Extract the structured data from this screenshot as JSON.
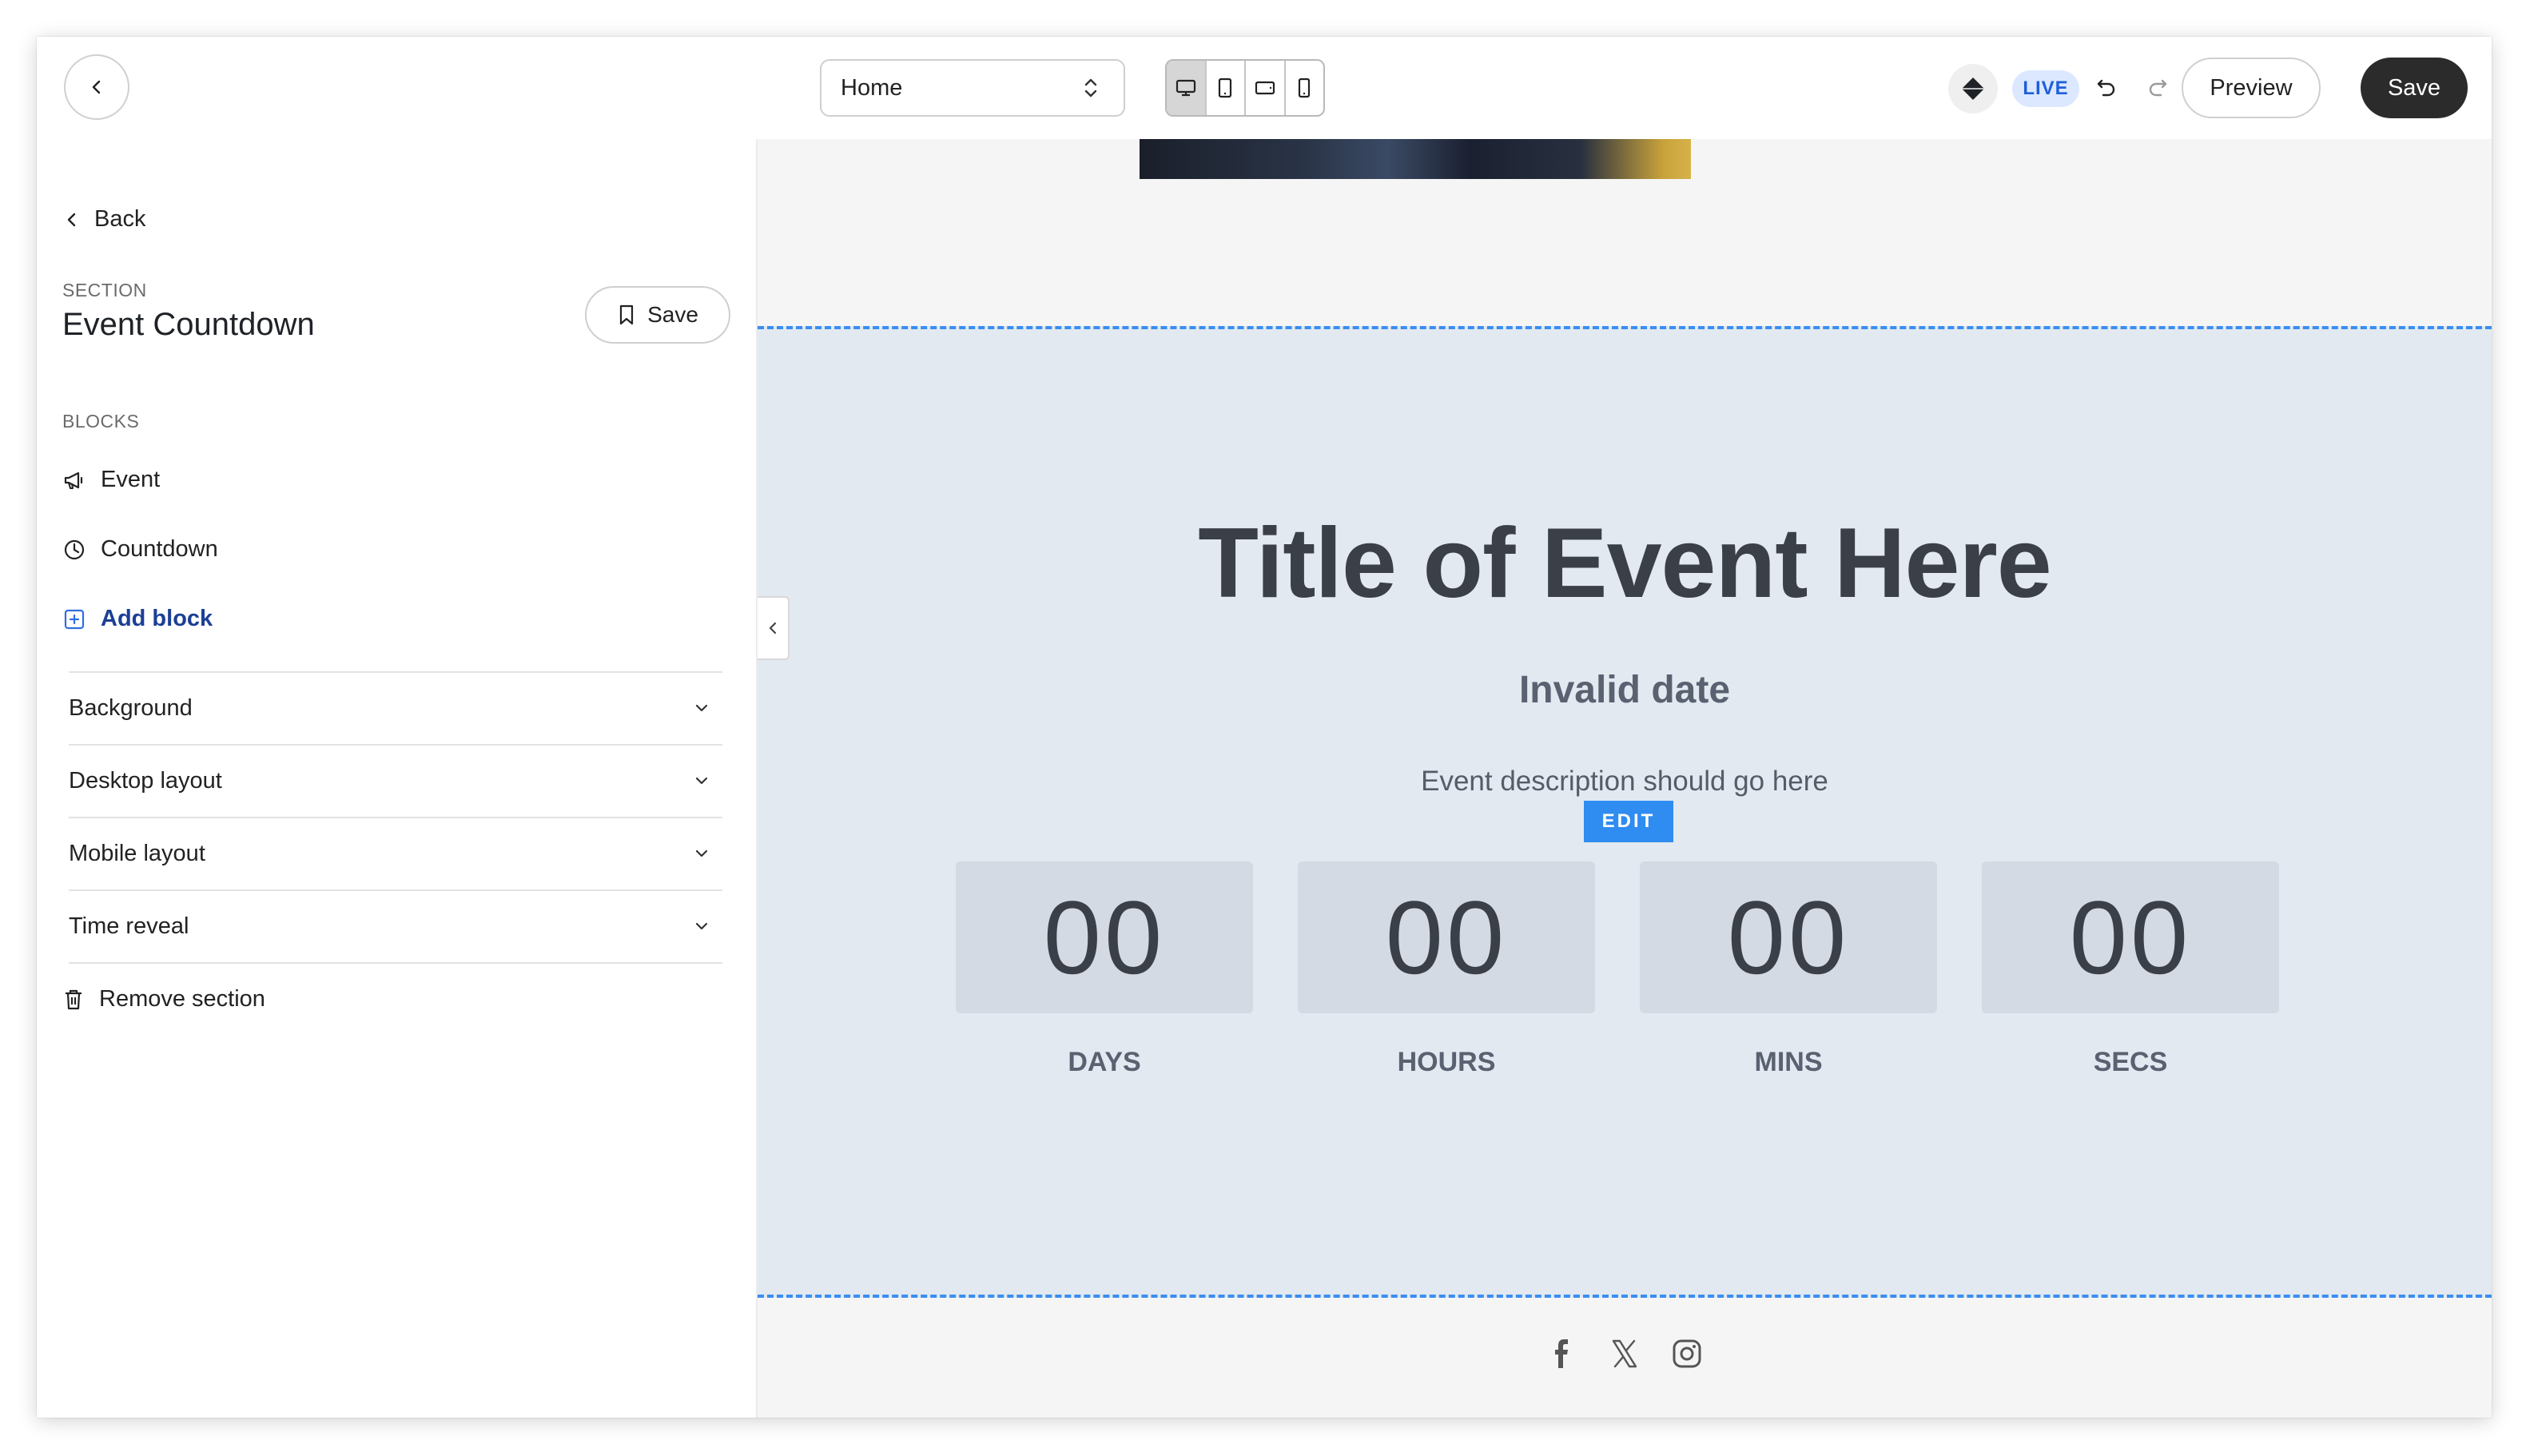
{
  "topbar": {
    "page_select": "Home",
    "live_badge": "LIVE",
    "preview_label": "Preview",
    "save_label": "Save",
    "device_modes": [
      "desktop",
      "tablet",
      "tablet-landscape",
      "mobile"
    ],
    "active_device": "desktop"
  },
  "sidebar": {
    "back_label": "Back",
    "section_label": "SECTION",
    "section_title": "Event Countdown",
    "save_label": "Save",
    "blocks_label": "BLOCKS",
    "blocks": [
      {
        "label": "Event",
        "icon": "megaphone-icon"
      },
      {
        "label": "Countdown",
        "icon": "clock-icon"
      }
    ],
    "add_block_label": "Add block",
    "accordions": [
      "Background",
      "Desktop layout",
      "Mobile layout",
      "Time reveal"
    ],
    "remove_label": "Remove section"
  },
  "canvas": {
    "title": "Title of Event Here",
    "date": "Invalid date",
    "description": "Event description should go here",
    "edit_label": "EDIT",
    "countdown": [
      {
        "value": "00",
        "label": "DAYS"
      },
      {
        "value": "00",
        "label": "HOURS"
      },
      {
        "value": "00",
        "label": "MINS"
      },
      {
        "value": "00",
        "label": "SECS"
      }
    ],
    "socials": [
      "facebook-icon",
      "x-icon",
      "instagram-icon"
    ]
  },
  "colors": {
    "accent_blue": "#3b8ef0",
    "section_bg": "#e2e9f1",
    "countdown_box": "#d3dae3",
    "live_bg": "#dbe8ff",
    "live_text": "#1f5ed8",
    "save_dark": "#2b2b2b"
  }
}
